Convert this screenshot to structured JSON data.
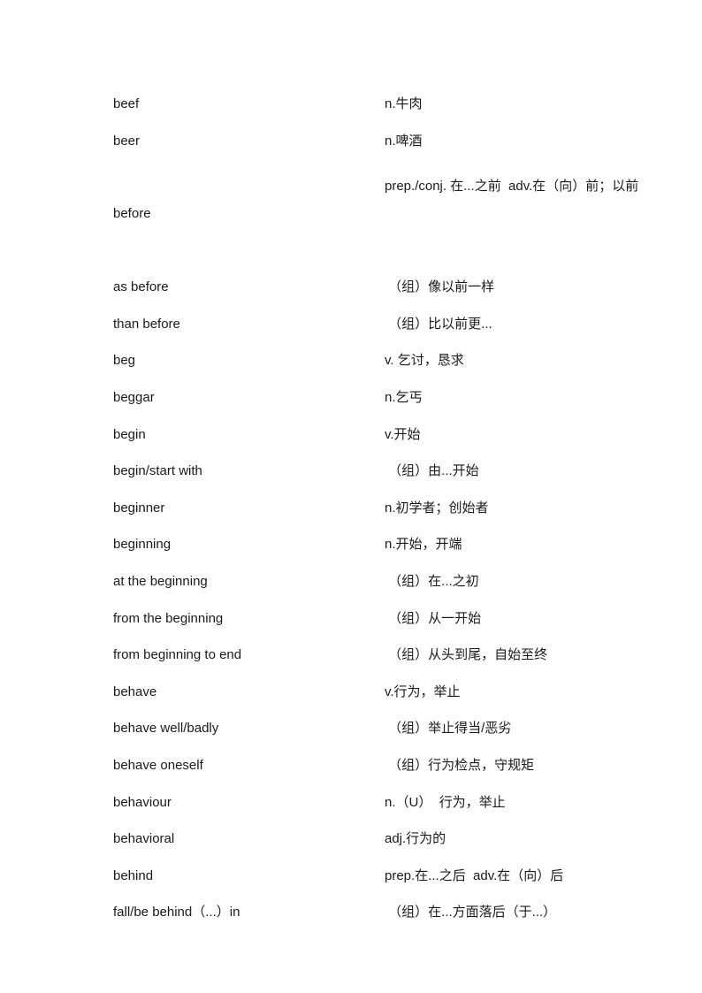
{
  "document": {
    "type": "vocabulary-glossary",
    "language_pair": "English-Chinese",
    "background_color": "#ffffff",
    "text_color": "#1a1a1a",
    "columns": [
      "term",
      "definition"
    ]
  },
  "entries": [
    {
      "term": "beef",
      "definition": "n.牛肉",
      "wraps": false
    },
    {
      "term": "beer",
      "definition": "n.啤酒",
      "wraps": false
    },
    {
      "term": "before",
      "definition": "prep./conj. 在...之前  adv.在（向）前；以前",
      "wraps": true
    },
    {
      "term": "as before",
      "definition": " （组）像以前一样",
      "wraps": false
    },
    {
      "term": "than before",
      "definition": " （组）比以前更...",
      "wraps": false
    },
    {
      "term": "beg",
      "definition": "v. 乞讨，恳求",
      "wraps": false
    },
    {
      "term": "beggar",
      "definition": "n.乞丐",
      "wraps": false
    },
    {
      "term": "begin",
      "definition": "v.开始",
      "wraps": false
    },
    {
      "term": "begin/start with",
      "definition": " （组）由...开始",
      "wraps": false
    },
    {
      "term": "beginner",
      "definition": "n.初学者；创始者",
      "wraps": false
    },
    {
      "term": "beginning",
      "definition": "n.开始，开端",
      "wraps": false
    },
    {
      "term": "at the beginning",
      "definition": " （组）在...之初",
      "wraps": false
    },
    {
      "term": "from the beginning",
      "definition": " （组）从一开始",
      "wraps": false
    },
    {
      "term": "from beginning to end",
      "definition": " （组）从头到尾，自始至终",
      "wraps": false
    },
    {
      "term": "behave",
      "definition": "v.行为，举止",
      "wraps": false
    },
    {
      "term": "behave well/badly",
      "definition": " （组）举止得当/恶劣",
      "wraps": false
    },
    {
      "term": "behave oneself",
      "definition": " （组）行为检点，守规矩",
      "wraps": false
    },
    {
      "term": "behaviour",
      "definition": "n.（U）  行为，举止",
      "wraps": false
    },
    {
      "term": "behavioral",
      "definition": "adj.行为的",
      "wraps": false
    },
    {
      "term": "behind",
      "definition": "prep.在...之后  adv.在（向）后",
      "wraps": false
    },
    {
      "term": "fall/be behind（...）in",
      "definition": " （组）在...方面落后（于...）",
      "wraps": false
    }
  ]
}
